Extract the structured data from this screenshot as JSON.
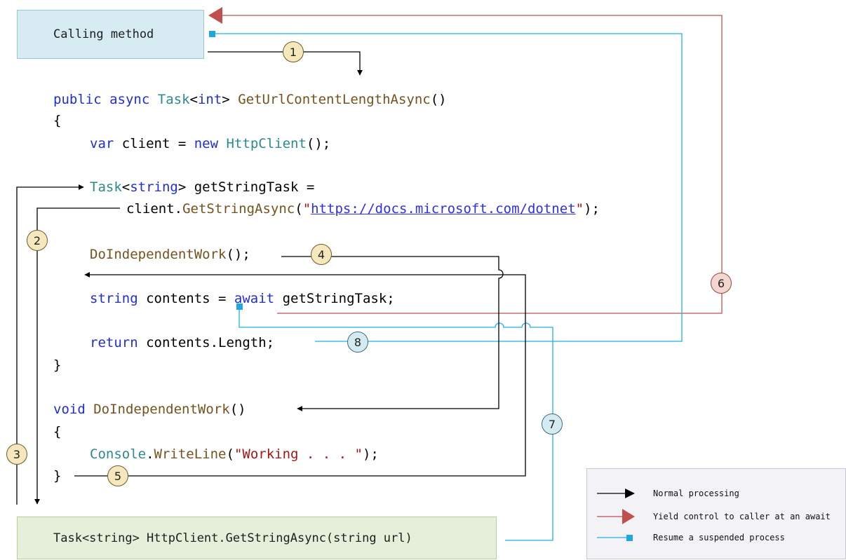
{
  "calling_box": {
    "label": "Calling method"
  },
  "gsa_box": {
    "label": "Task<string> HttpClient.GetStringAsync(string url)"
  },
  "code": {
    "l1": {
      "kw1": "public",
      "kw2": "async",
      "ty1": "Task",
      "p1": "<",
      "kw3": "int",
      "p2": "> ",
      "fn1": "GetUrlContentLengthAsync",
      "p3": "()"
    },
    "l2": "{",
    "l3": {
      "kw1": "var",
      "p1": " client = ",
      "kw2": "new",
      "p2": " ",
      "ty1": "HttpClient",
      "p3": "();"
    },
    "l4": {
      "ty1": "Task",
      "p1": "<",
      "kw1": "string",
      "p2": "> getStringTask ="
    },
    "l5": {
      "p1": "client.",
      "fn1": "GetStringAsync",
      "p2": "(",
      "st1": "\"",
      "url": "https://docs.microsoft.com/dotnet",
      "st2": "\"",
      "p3": ");"
    },
    "l6": {
      "fn1": "DoIndependentWork",
      "p1": "();"
    },
    "l7": {
      "kw1": "string",
      "p1": " contents = ",
      "kw2": "await",
      "p2": " getStringTask;"
    },
    "l8": {
      "kw1": "return",
      "p1": " contents.Length;"
    },
    "l9": "}",
    "l10": {
      "kw1": "void",
      "p1": " ",
      "fn1": "DoIndependentWork",
      "p2": "()"
    },
    "l11": "{",
    "l12": {
      "ty1": "Console",
      "p1": ".",
      "fn1": "WriteLine",
      "p2": "(",
      "st1": "\"Working . . . \"",
      "p3": ");"
    },
    "l13": "}"
  },
  "badges": {
    "b1": "1",
    "b2": "2",
    "b3": "3",
    "b4": "4",
    "b5": "5",
    "b6": "6",
    "b7": "7",
    "b8": "8"
  },
  "legend": {
    "normal": "Normal processing",
    "yield": "Yield control to caller at an await",
    "resume": "Resume a suspended process"
  },
  "colors": {
    "normal": "#000000",
    "yield": "#c0504d",
    "resume": "#1fb1e6"
  }
}
